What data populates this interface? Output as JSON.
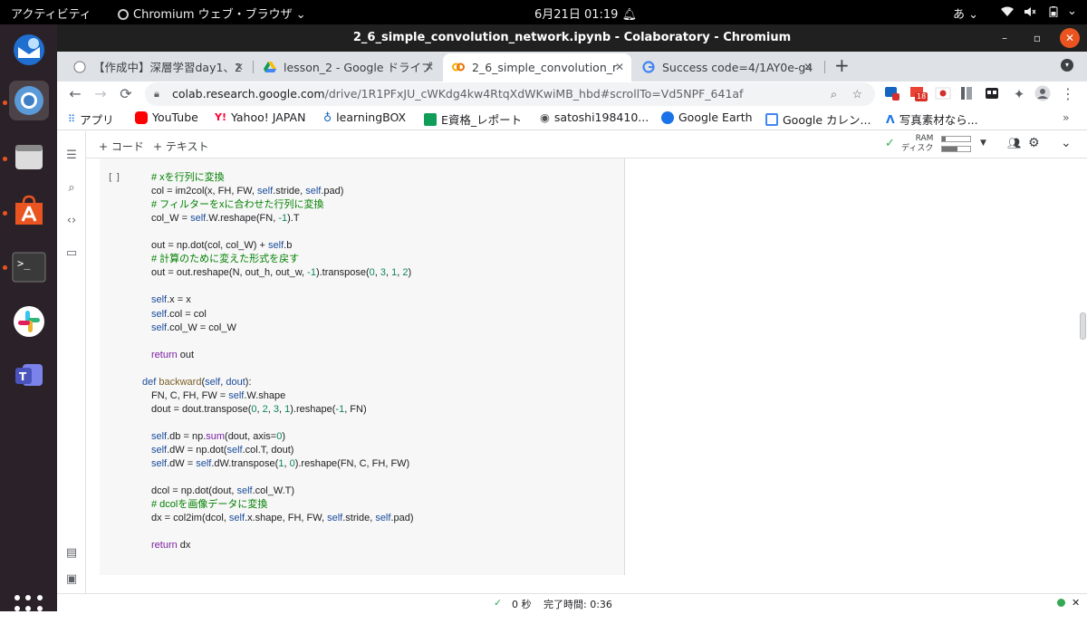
{
  "topbar": {
    "activities": "アクティビティ",
    "app_name": "Chromium ウェブ・ブラウザ",
    "clock": "6月21日  01:19",
    "input_method": "あ"
  },
  "window": {
    "title": "2_6_simple_convolution_network.ipynb - Colaboratory - Chromium",
    "minimize": "–",
    "maximize": "▫",
    "close": "✕"
  },
  "tabs": [
    {
      "label": "【作成中】深層学習day1、2"
    },
    {
      "label": "lesson_2 - Google ドライブ"
    },
    {
      "label": "2_6_simple_convolution_r"
    },
    {
      "label": "Success code=4/1AY0e-g4"
    }
  ],
  "tab_close": "✕",
  "new_tab": "+",
  "omnibox": {
    "host": "colab.research.google.com",
    "path": "/drive/1R1PFxJU_cWKdg4kw4RtqXdWKwiMB_hbd#scrollTo=Vd5NPF_641af"
  },
  "badge_count": "18",
  "bookmarks": [
    {
      "label": "アプリ"
    },
    {
      "label": "YouTube"
    },
    {
      "label": "Yahoo! JAPAN"
    },
    {
      "label": "learningBOX"
    },
    {
      "label": "E資格_レポート"
    },
    {
      "label": "satoshi198410..."
    },
    {
      "label": "Google Earth"
    },
    {
      "label": "Google カレン..."
    },
    {
      "label": "写真素材なら..."
    }
  ],
  "colab": {
    "add_code": "+ コード",
    "add_text": "+ テキスト",
    "ram_label": "RAM",
    "disk_label": "ディスク",
    "ram_usage": 0.12,
    "disk_usage": 0.55,
    "cell_bracket": "[ ]"
  },
  "code_lines": [
    [
      {
        "t": "# xを行列に変換",
        "c": "cmt"
      }
    ],
    [
      {
        "t": "col = im2col(x, FH, FW, "
      },
      {
        "t": "self",
        "c": "slf"
      },
      {
        "t": ".stride, "
      },
      {
        "t": "self",
        "c": "slf"
      },
      {
        "t": ".pad)"
      }
    ],
    [
      {
        "t": "# フィルターをxに合わせた行列に変換",
        "c": "cmt"
      }
    ],
    [
      {
        "t": "col_W = "
      },
      {
        "t": "self",
        "c": "slf"
      },
      {
        "t": ".W.reshape(FN, "
      },
      {
        "t": "-1",
        "c": "num"
      },
      {
        "t": ").T"
      }
    ],
    [],
    [
      {
        "t": "out = np.dot(col, col_W) + "
      },
      {
        "t": "self",
        "c": "slf"
      },
      {
        "t": ".b"
      }
    ],
    [
      {
        "t": "# 計算のために変えた形式を戻す",
        "c": "cmt"
      }
    ],
    [
      {
        "t": "out = out.reshape(N, out_h, out_w, "
      },
      {
        "t": "-1",
        "c": "num"
      },
      {
        "t": ").transpose("
      },
      {
        "t": "0",
        "c": "num"
      },
      {
        "t": ", "
      },
      {
        "t": "3",
        "c": "num"
      },
      {
        "t": ", "
      },
      {
        "t": "1",
        "c": "num"
      },
      {
        "t": ", "
      },
      {
        "t": "2",
        "c": "num"
      },
      {
        "t": ")"
      }
    ],
    [],
    [
      {
        "t": "self",
        "c": "slf"
      },
      {
        "t": ".x = x"
      }
    ],
    [
      {
        "t": "self",
        "c": "slf"
      },
      {
        "t": ".col = col"
      }
    ],
    [
      {
        "t": "self",
        "c": "slf"
      },
      {
        "t": ".col_W = col_W"
      }
    ],
    [],
    [
      {
        "t": "return",
        "c": "kw"
      },
      {
        "t": " out"
      }
    ],
    [],
    [
      {
        "t": "def",
        "c": "slf"
      },
      {
        "t": " "
      },
      {
        "t": "backward",
        "c": "fn"
      },
      {
        "t": "("
      },
      {
        "t": "self",
        "c": "slf"
      },
      {
        "t": ", "
      },
      {
        "t": "dout",
        "c": "slf"
      },
      {
        "t": "):"
      }
    ],
    [
      {
        "t": "FN, C, FH, FW = "
      },
      {
        "t": "self",
        "c": "slf"
      },
      {
        "t": ".W.shape"
      }
    ],
    [
      {
        "t": "dout = dout.transpose("
      },
      {
        "t": "0",
        "c": "num"
      },
      {
        "t": ", "
      },
      {
        "t": "2",
        "c": "num"
      },
      {
        "t": ", "
      },
      {
        "t": "3",
        "c": "num"
      },
      {
        "t": ", "
      },
      {
        "t": "1",
        "c": "num"
      },
      {
        "t": ").reshape("
      },
      {
        "t": "-1",
        "c": "num"
      },
      {
        "t": ", FN)"
      }
    ],
    [],
    [
      {
        "t": "self",
        "c": "slf"
      },
      {
        "t": ".db = np."
      },
      {
        "t": "sum",
        "c": "kw"
      },
      {
        "t": "(dout, axis="
      },
      {
        "t": "0",
        "c": "num"
      },
      {
        "t": ")"
      }
    ],
    [
      {
        "t": "self",
        "c": "slf"
      },
      {
        "t": ".dW = np.dot("
      },
      {
        "t": "self",
        "c": "slf"
      },
      {
        "t": ".col.T, dout)"
      }
    ],
    [
      {
        "t": "self",
        "c": "slf"
      },
      {
        "t": ".dW = "
      },
      {
        "t": "self",
        "c": "slf"
      },
      {
        "t": ".dW.transpose("
      },
      {
        "t": "1",
        "c": "num"
      },
      {
        "t": ", "
      },
      {
        "t": "0",
        "c": "num"
      },
      {
        "t": ").reshape(FN, C, FH, FW)"
      }
    ],
    [],
    [
      {
        "t": "dcol = np.dot(dout, "
      },
      {
        "t": "self",
        "c": "slf"
      },
      {
        "t": ".col_W.T)"
      }
    ],
    [
      {
        "t": "# dcolを画像データに変換",
        "c": "cmt"
      }
    ],
    [
      {
        "t": "dx = col2im(dcol, "
      },
      {
        "t": "self",
        "c": "slf"
      },
      {
        "t": ".x.shape, FH, FW, "
      },
      {
        "t": "self",
        "c": "slf"
      },
      {
        "t": ".stride, "
      },
      {
        "t": "self",
        "c": "slf"
      },
      {
        "t": ".pad)"
      }
    ],
    [],
    [
      {
        "t": "return",
        "c": "kw"
      },
      {
        "t": " dx"
      }
    ]
  ],
  "code_indent": [
    1,
    1,
    1,
    1,
    0,
    1,
    1,
    1,
    0,
    1,
    1,
    1,
    0,
    1,
    0,
    0,
    1,
    1,
    0,
    1,
    1,
    1,
    0,
    1,
    1,
    1,
    0,
    1
  ],
  "status": {
    "check": "✓",
    "elapsed": "0 秒",
    "completed": "完了時間: 0:36"
  },
  "colors": {
    "accent_orange": "#e95420",
    "comment_green": "#008000",
    "keyword_purple": "#7b1fa2",
    "self_blue": "#1a4c9b",
    "status_green": "#34a853"
  }
}
